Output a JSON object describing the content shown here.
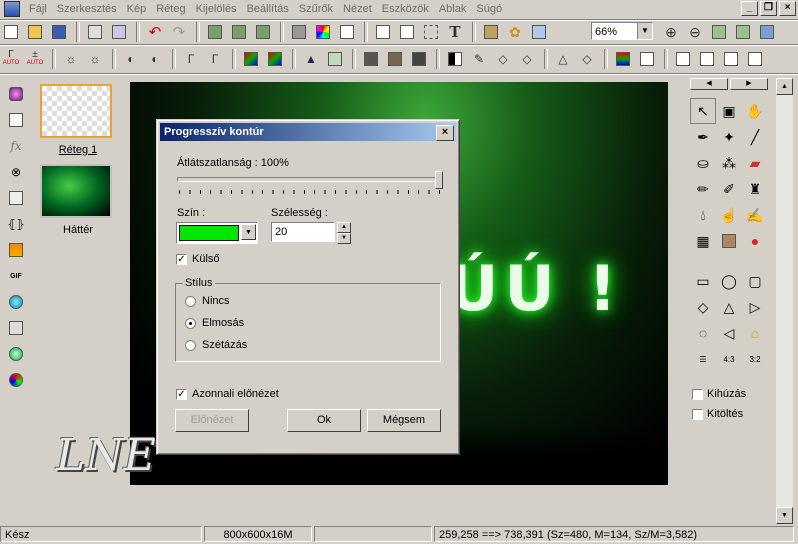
{
  "menu": [
    "Fájl",
    "Szerkesztés",
    "Kép",
    "Réteg",
    "Kijelölés",
    "Beállítás",
    "Szűrők",
    "Nézet",
    "Eszközök",
    "Ablak",
    "Súgó"
  ],
  "zoom": {
    "value": "66%"
  },
  "toolbar2": {
    "auto1": "AUTO",
    "auto2": "AUTO"
  },
  "layers": [
    {
      "name": "Réteg 1"
    },
    {
      "name": "Háttér"
    }
  ],
  "image": {
    "text_art": "ÚÚ !"
  },
  "watermark": "LNE",
  "right_panel": {
    "kihuzas": "Kihúzás",
    "kitoltes": "Kitöltés"
  },
  "statusbar": {
    "status": "Kész",
    "size": "800x600x16M",
    "coords": "259,258 ==> 738,391 (Sz=480, M=134, Sz/M=3,582)"
  },
  "dialog": {
    "title": "Progresszív kontúr",
    "opacity_label": "Átlátszatlanság : 100%",
    "opacity_value": 100,
    "color_label": "Szín :",
    "color_value": "#00e600",
    "width_label": "Szélesség :",
    "width_value": "20",
    "outer_label": "Külső",
    "outer_checked": true,
    "style_group": "Stílus",
    "styles": [
      "Nincs",
      "Elmosás",
      "Szétázás"
    ],
    "style_selected": "Elmosás",
    "preview_live_label": "Azonnali előnézet",
    "preview_live_checked": true,
    "buttons": {
      "preview": "Előnézet",
      "ok": "Ok",
      "cancel": "Mégsem"
    }
  }
}
